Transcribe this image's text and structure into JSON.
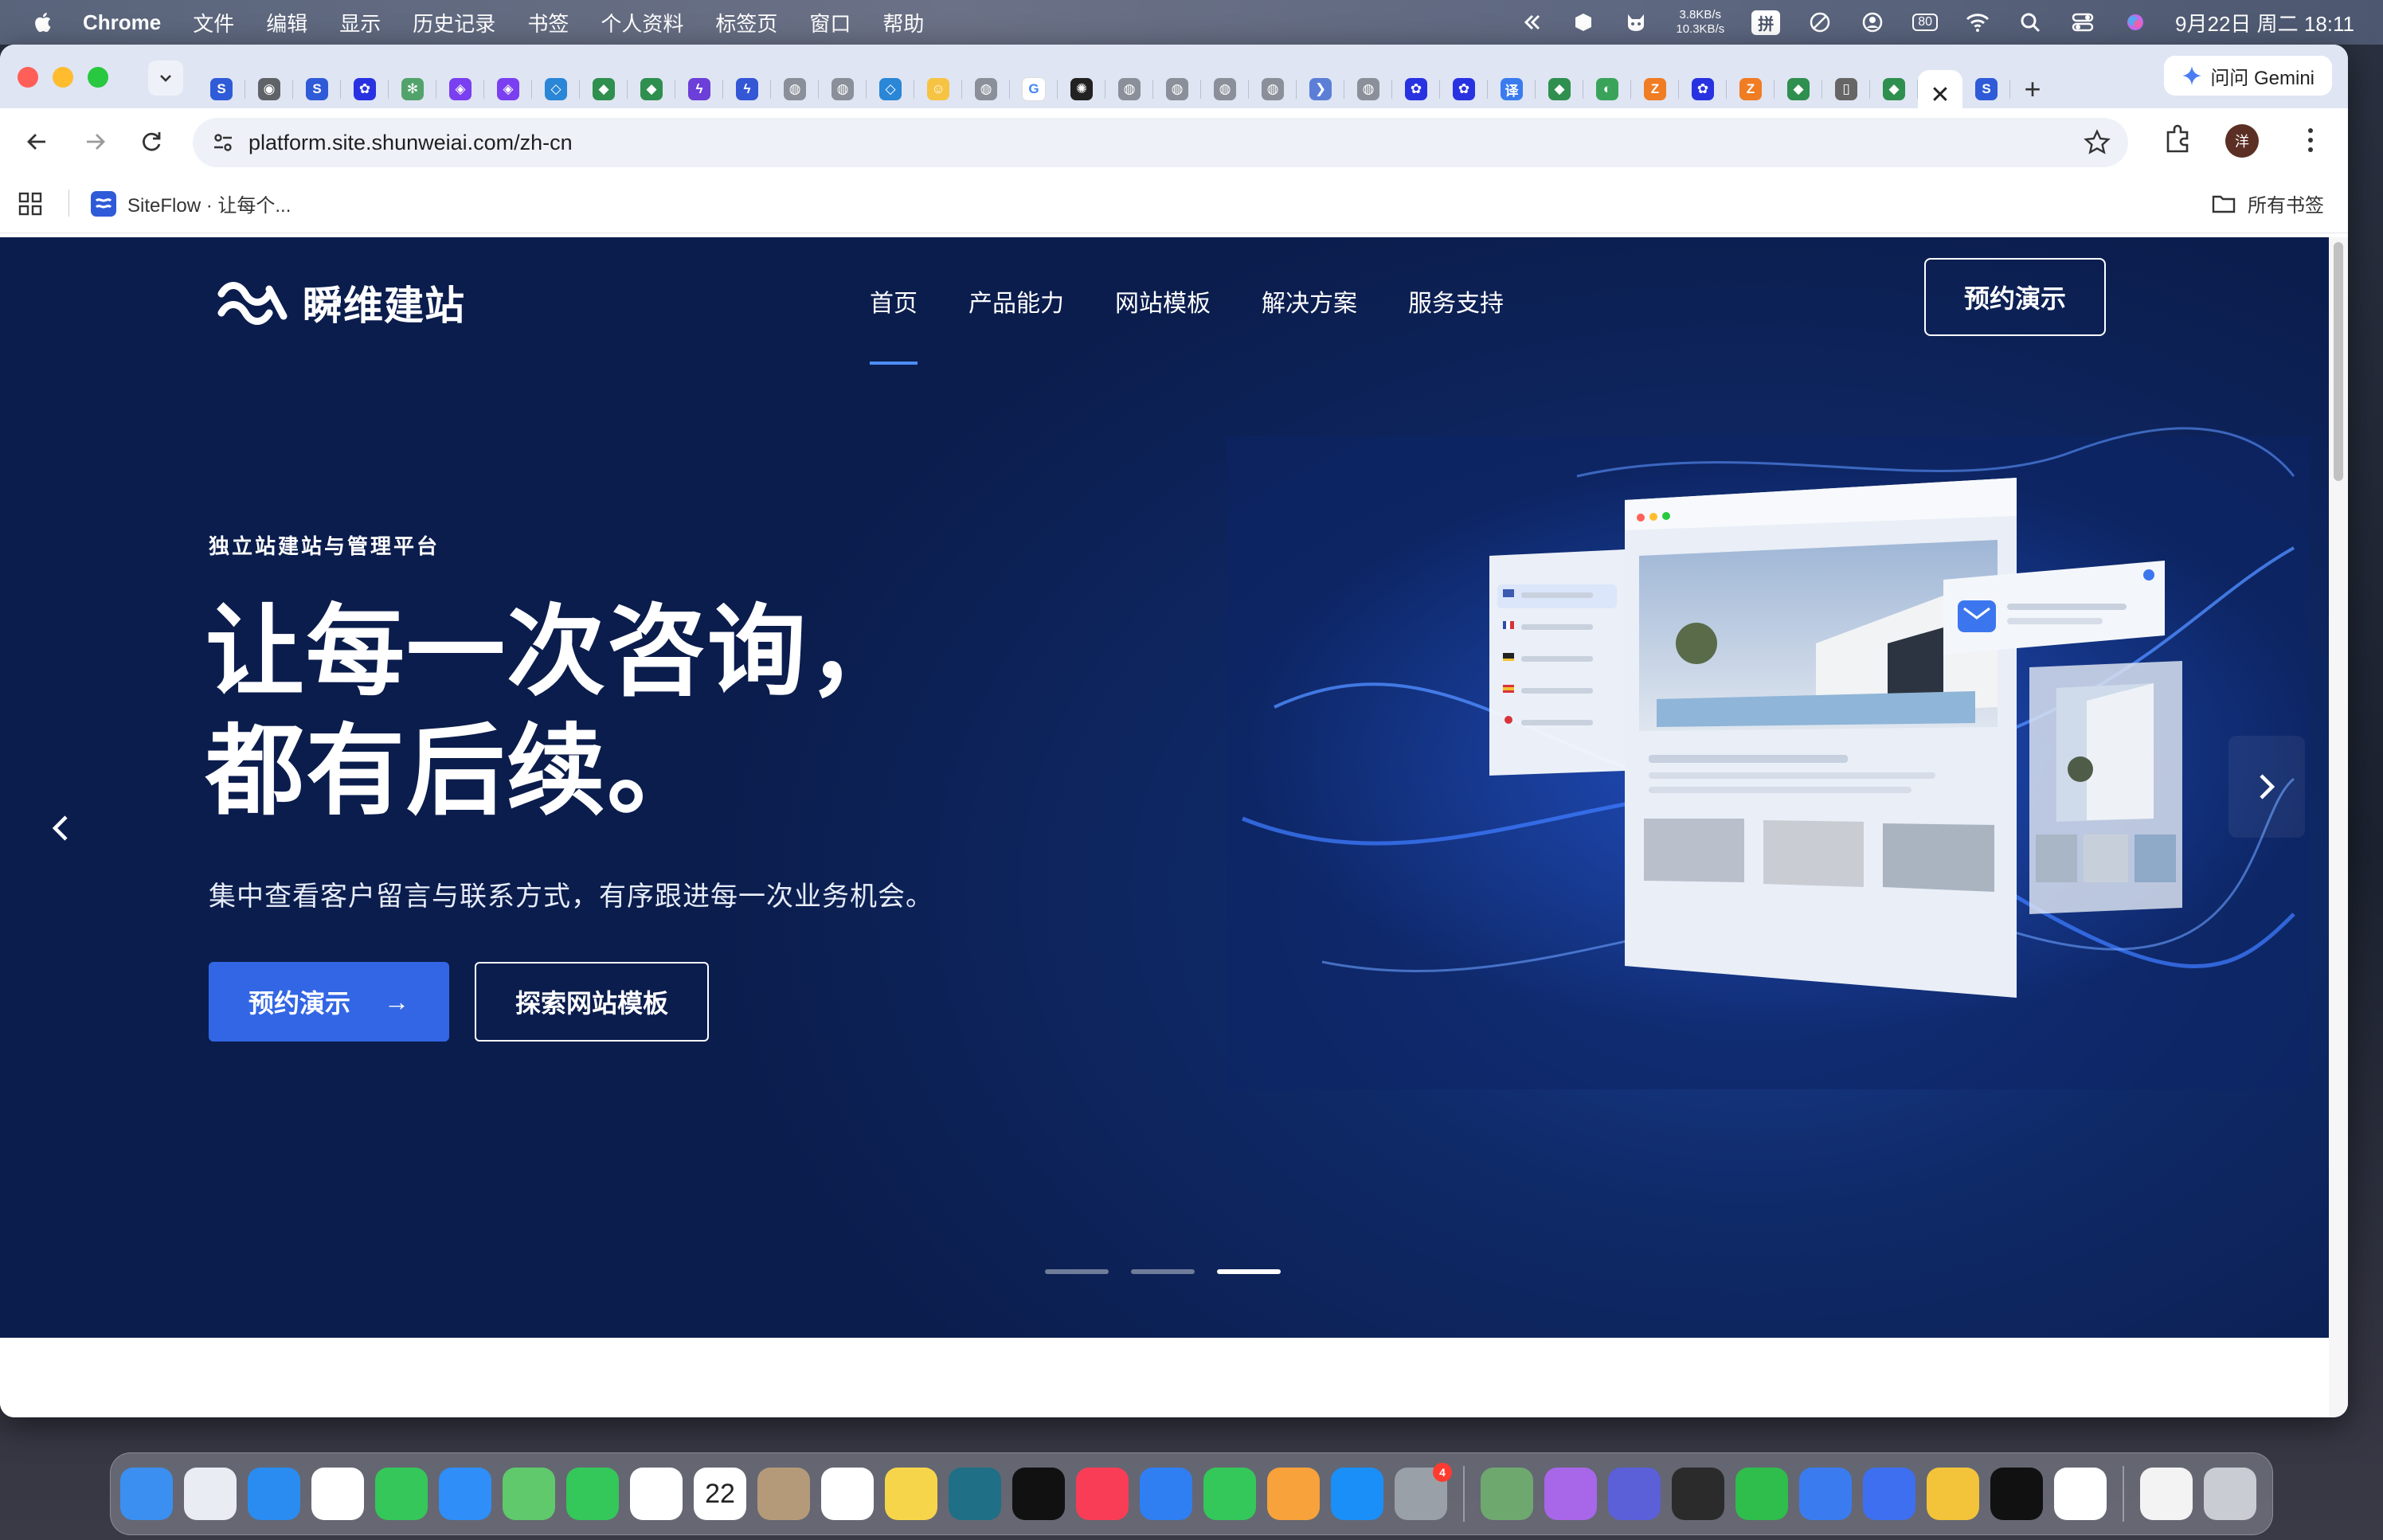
{
  "menubar": {
    "items": [
      "Chrome",
      "文件",
      "编辑",
      "显示",
      "历史记录",
      "书签",
      "个人资料",
      "标签页",
      "窗口",
      "帮助"
    ],
    "net_up": "3.8KB/s",
    "net_down": "10.3KB/s",
    "input_method": "拼",
    "battery": "80",
    "datetime": "9月22日 周二  18:11"
  },
  "browser": {
    "gemini_label": "问问 Gemini",
    "url": "platform.site.shunweiai.com/zh-cn",
    "profile_initial": "洋",
    "bookmark_label": "SiteFlow · 让每个...",
    "all_bookmarks": "所有书签",
    "tab_favicons": [
      {
        "icon": "siteflow-icon",
        "color": "#2f5bd8",
        "glyph": "S"
      },
      {
        "icon": "chrome-icon",
        "color": "#5f6368",
        "glyph": "◉"
      },
      {
        "icon": "siteflow-icon",
        "color": "#2f5bd8",
        "glyph": "S"
      },
      {
        "icon": "baidu-icon",
        "color": "#2932e1",
        "glyph": "✿"
      },
      {
        "icon": "leaf-icon",
        "color": "#52a36b",
        "glyph": "✻"
      },
      {
        "icon": "cube-icon",
        "color": "#7a3ff0",
        "glyph": "◈"
      },
      {
        "icon": "cube-icon",
        "color": "#7a3ff0",
        "glyph": "◈"
      },
      {
        "icon": "diamond-icon",
        "color": "#2a86d6",
        "glyph": "◇"
      },
      {
        "icon": "shield-icon",
        "color": "#2f8f4e",
        "glyph": "◆"
      },
      {
        "icon": "shield-icon",
        "color": "#2f8f4e",
        "glyph": "◆"
      },
      {
        "icon": "bolt-icon",
        "color": "#6b3fd8",
        "glyph": "ϟ"
      },
      {
        "icon": "bolt-circle-icon",
        "color": "#3457d5",
        "glyph": "ϟ"
      },
      {
        "icon": "globe-icon",
        "color": "#8a8f99",
        "glyph": "◍"
      },
      {
        "icon": "globe-icon",
        "color": "#8a8f99",
        "glyph": "◍"
      },
      {
        "icon": "diamond-icon",
        "color": "#2a86d6",
        "glyph": "◇"
      },
      {
        "icon": "hugging-face-icon",
        "color": "#f6c343",
        "glyph": "☺"
      },
      {
        "icon": "globe-icon",
        "color": "#8a8f99",
        "glyph": "◍"
      },
      {
        "icon": "google-icon",
        "color": "#ffffff",
        "glyph": "G"
      },
      {
        "icon": "openai-icon",
        "color": "#222222",
        "glyph": "✺"
      },
      {
        "icon": "globe-icon",
        "color": "#8a8f99",
        "glyph": "◍"
      },
      {
        "icon": "globe-icon",
        "color": "#8a8f99",
        "glyph": "◍"
      },
      {
        "icon": "globe-icon",
        "color": "#8a8f99",
        "glyph": "◍"
      },
      {
        "icon": "globe-icon",
        "color": "#8a8f99",
        "glyph": "◍"
      },
      {
        "icon": "arrow-icon",
        "color": "#5b7fd6",
        "glyph": "❯"
      },
      {
        "icon": "globe-icon",
        "color": "#8a8f99",
        "glyph": "◍"
      },
      {
        "icon": "baidu-icon",
        "color": "#2932e1",
        "glyph": "✿"
      },
      {
        "icon": "baidu-icon",
        "color": "#2932e1",
        "glyph": "✿"
      },
      {
        "icon": "translate-icon",
        "color": "#3a7bef",
        "glyph": "译"
      },
      {
        "icon": "shield-icon",
        "color": "#2f8f4e",
        "glyph": "◆"
      },
      {
        "icon": "gauge-icon",
        "color": "#3aa35a",
        "glyph": "◐"
      },
      {
        "icon": "zhihu-icon",
        "color": "#f07c23",
        "glyph": "Z"
      },
      {
        "icon": "baidu-icon",
        "color": "#2932e1",
        "glyph": "✿"
      },
      {
        "icon": "zhihu-icon",
        "color": "#f07c23",
        "glyph": "Z"
      },
      {
        "icon": "shield-icon",
        "color": "#2f8f4e",
        "glyph": "◆"
      },
      {
        "icon": "doc-icon",
        "color": "#666666",
        "glyph": "▯"
      },
      {
        "icon": "shield-icon",
        "color": "#2f8f4e",
        "glyph": "◆"
      }
    ]
  },
  "site": {
    "logo_text": "瞬维建站",
    "nav": [
      "首页",
      "产品能力",
      "网站模板",
      "解决方案",
      "服务支持"
    ],
    "nav_active_index": 0,
    "header_cta": "预约演示",
    "kicker": "独立站建站与管理平台",
    "headline_line1": "让每一次咨询，",
    "headline_line2": "都有后续。",
    "subtext": "集中查看客户留言与联系方式，有序跟进每一次业务机会。",
    "primary_btn": "预约演示",
    "primary_btn_arrow": "→",
    "secondary_btn": "探索网站模板",
    "carousel_total": 3,
    "carousel_active": 3,
    "colors": {
      "hero_bg": "#0f2a68",
      "accent": "#3366e4",
      "nav_underline": "#4d8df5"
    }
  },
  "dock": {
    "calendar_day": "22",
    "settings_badge": "4",
    "apps": [
      {
        "name": "finder-icon",
        "color": "#3b8ff0"
      },
      {
        "name": "launchpad-icon",
        "color": "#e9ecf2"
      },
      {
        "name": "safari-icon",
        "color": "#2a8cf0"
      },
      {
        "name": "chrome-icon",
        "color": "#ffffff"
      },
      {
        "name": "messages-icon",
        "color": "#35c759"
      },
      {
        "name": "mail-icon",
        "color": "#2f8ef7"
      },
      {
        "name": "maps-icon",
        "color": "#5fc96b"
      },
      {
        "name": "facetime-icon",
        "color": "#34c759"
      },
      {
        "name": "photos-icon",
        "color": "#ffffff"
      },
      {
        "name": "calendar-icon",
        "color": "#ffffff"
      },
      {
        "name": "contacts-icon",
        "color": "#b59a7a"
      },
      {
        "name": "reminders-icon",
        "color": "#ffffff"
      },
      {
        "name": "notes-icon",
        "color": "#f7d54a"
      },
      {
        "name": "freeform-icon",
        "color": "#1f6f86"
      },
      {
        "name": "appletv-icon",
        "color": "#111111"
      },
      {
        "name": "music-icon",
        "color": "#fa3d56"
      },
      {
        "name": "keynote-icon",
        "color": "#2f7ff3"
      },
      {
        "name": "numbers-icon",
        "color": "#34c759"
      },
      {
        "name": "pages-icon",
        "color": "#f7a23a"
      },
      {
        "name": "appstore-icon",
        "color": "#1a8ff7"
      },
      {
        "name": "settings-icon",
        "color": "#9aa0a8"
      },
      {
        "name": "divider"
      },
      {
        "name": "instruments-icon",
        "color": "#6fa86f"
      },
      {
        "name": "cat-app-icon",
        "color": "#a866e8"
      },
      {
        "name": "chat-app-icon",
        "color": "#5b5fd8"
      },
      {
        "name": "box-app-icon",
        "color": "#2b2b2b"
      },
      {
        "name": "wechat-icon",
        "color": "#2fbd4c"
      },
      {
        "name": "pen-app-icon",
        "color": "#3a7cf0"
      },
      {
        "name": "blue-app-icon",
        "color": "#3d6ff0"
      },
      {
        "name": "pawprint-app-icon",
        "color": "#f3c43a"
      },
      {
        "name": "intellij-icon",
        "color": "#111111"
      },
      {
        "name": "mailbird-icon",
        "color": "#ffffff"
      },
      {
        "name": "divider"
      },
      {
        "name": "file-icon",
        "color": "#f3f3f3"
      },
      {
        "name": "trash-icon",
        "color": "#c9ccd2"
      }
    ]
  }
}
